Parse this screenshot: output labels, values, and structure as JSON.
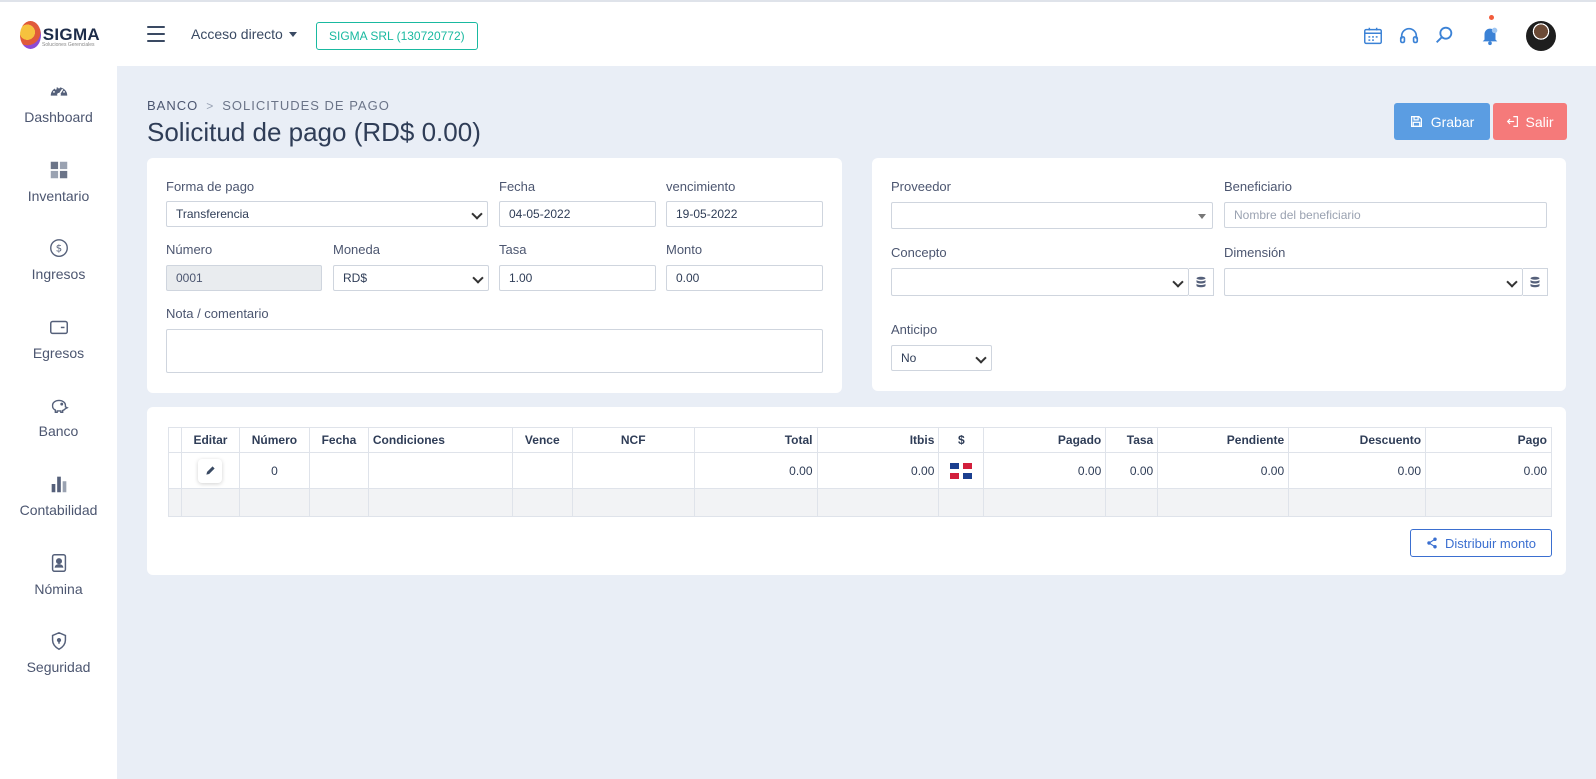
{
  "header": {
    "logo_text": "SIGMA",
    "logo_sub": "Soluciones Gerenciales",
    "acceso_label": "Acceso directo",
    "company_label": "SIGMA SRL (130720772)"
  },
  "sidebar": {
    "items": [
      {
        "label": "Dashboard",
        "icon": "gauge-icon"
      },
      {
        "label": "Inventario",
        "icon": "grid-icon"
      },
      {
        "label": "Ingresos",
        "icon": "coin-icon"
      },
      {
        "label": "Egresos",
        "icon": "wallet-icon"
      },
      {
        "label": "Banco",
        "icon": "piggy-bank-icon"
      },
      {
        "label": "Contabilidad",
        "icon": "bar-chart-icon"
      },
      {
        "label": "Nómina",
        "icon": "id-badge-icon"
      },
      {
        "label": "Seguridad",
        "icon": "shield-icon"
      }
    ]
  },
  "breadcrumb": {
    "root": "BANCO",
    "current": "SOLICITUDES DE PAGO"
  },
  "page_title": "Solicitud de pago (RD$ 0.00)",
  "actions": {
    "save_label": "Grabar",
    "exit_label": "Salir"
  },
  "form_left": {
    "forma_pago": {
      "label": "Forma de pago",
      "value": "Transferencia"
    },
    "fecha": {
      "label": "Fecha",
      "value": "04-05-2022"
    },
    "vencimiento": {
      "label": "vencimiento",
      "value": "19-05-2022"
    },
    "numero": {
      "label": "Número",
      "value": "0001"
    },
    "moneda": {
      "label": "Moneda",
      "value": "RD$"
    },
    "tasa": {
      "label": "Tasa",
      "value": "1.00"
    },
    "monto": {
      "label": "Monto",
      "value": "0.00"
    },
    "nota": {
      "label": "Nota / comentario",
      "value": ""
    }
  },
  "form_right": {
    "proveedor": {
      "label": "Proveedor",
      "value": ""
    },
    "beneficiario": {
      "label": "Beneficiario",
      "placeholder": "Nombre del beneficiario"
    },
    "concepto": {
      "label": "Concepto",
      "value": ""
    },
    "dimension": {
      "label": "Dimensión",
      "value": ""
    },
    "anticipo": {
      "label": "Anticipo",
      "value": "No"
    }
  },
  "table": {
    "columns": [
      "",
      "Editar",
      "Número",
      "Fecha",
      "Condiciones",
      "Vence",
      "NCF",
      "Total",
      "Itbis",
      "$",
      "Pagado",
      "Tasa",
      "Pendiente",
      "Descuento",
      "Pago"
    ],
    "row": {
      "numero": "0",
      "fecha": "",
      "condiciones": "",
      "vence": "",
      "ncf": "",
      "total": "0.00",
      "itbis": "0.00",
      "currency_flag": "dominican-republic-flag",
      "pagado": "0.00",
      "tasa": "0.00",
      "pendiente": "0.00",
      "descuento": "0.00",
      "pago": "0.00"
    }
  },
  "distribute_label": "Distribuir monto",
  "colors": {
    "accent_blue": "#5b9de2",
    "danger_red": "#f57a7a",
    "company_teal": "#19b9a0",
    "link_blue": "#3b6fd0",
    "background": "#e9eef6"
  }
}
